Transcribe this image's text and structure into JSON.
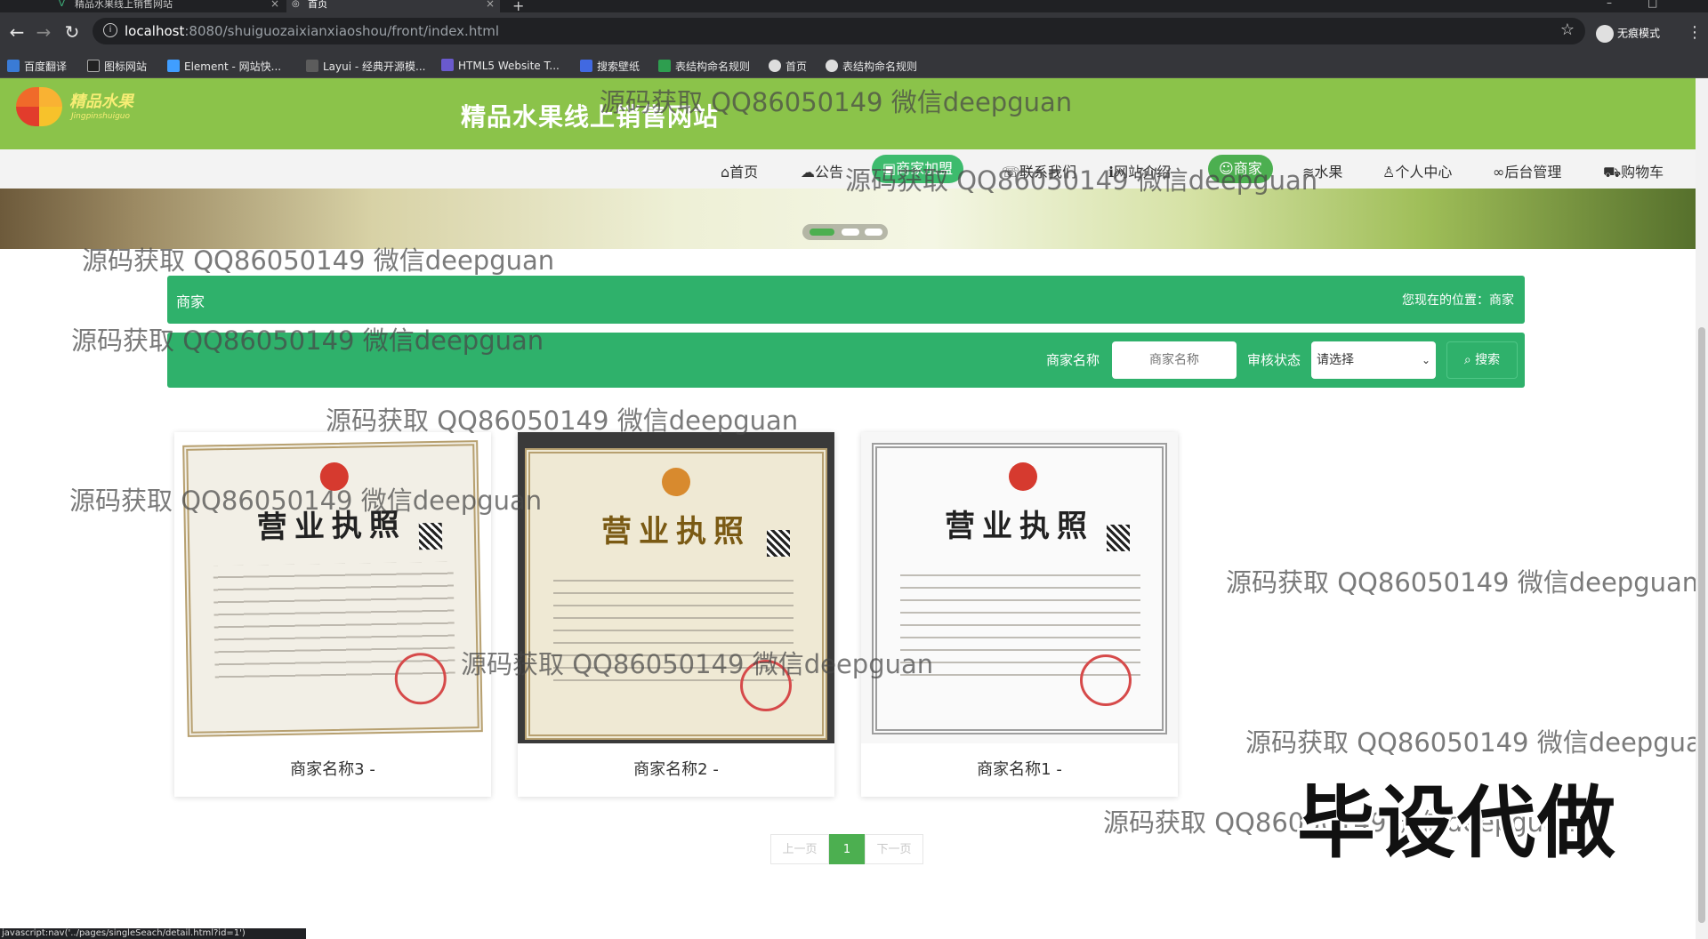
{
  "browser": {
    "tabs": [
      {
        "title": "精品水果线上销售网站"
      },
      {
        "title": "首页"
      }
    ],
    "url_host": "localhost",
    "url_rest": ":8080/shuiguozaixianxiaoshou/front/index.html",
    "profile_label": "无痕模式",
    "bookmarks": [
      "百度翻译",
      "图标网站",
      "Element - 网站快...",
      "Layui - 经典开源模...",
      "HTML5 Website T...",
      "搜索壁纸",
      "表结构命名规则",
      "首页",
      "表结构命名规则"
    ],
    "status_url": "javascript:nav('../pages/singleSeach/detail.html?id=1')"
  },
  "site": {
    "logo_text": "精品水果",
    "logo_sub": "Jingpinshuiguo",
    "title": "精品水果线上销售网站"
  },
  "nav": {
    "items": [
      "首页",
      "公告",
      "商家加盟",
      "联系我们",
      "网站介绍",
      "商家",
      "水果",
      "个人中心",
      "后台管理",
      "购物车"
    ],
    "icons": [
      "home-icon",
      "cloud-icon",
      "join-icon",
      "contact-icon",
      "info-icon",
      "store-icon",
      "fruit-icon",
      "user-icon",
      "link-icon",
      "cart-icon"
    ]
  },
  "banner": {
    "slide_count": 3,
    "active_index": 0
  },
  "section": {
    "title": "商家",
    "location": "您现在的位置：商家"
  },
  "search": {
    "name_label": "商家名称",
    "name_placeholder": "商家名称",
    "status_label": "审核状态",
    "status_selected": "请选择",
    "button_label": "搜索"
  },
  "cards": [
    {
      "name": "商家名称3 -",
      "image_caption": "营业执照"
    },
    {
      "name": "商家名称2 -",
      "image_caption": "营业执照"
    },
    {
      "name": "商家名称1 -",
      "image_caption": "营业执照"
    }
  ],
  "pager": {
    "prev": "上一页",
    "current": "1",
    "next": "下一页"
  },
  "overlays": {
    "watermark": "源码获取 QQ86050149 微信deepguan",
    "watermark_cut": "源码获取 QQ86050149 微信deepgua",
    "stamp": "毕设代做"
  },
  "colors": {
    "header_green": "#8bc34a",
    "accent_green": "#2fb16b",
    "pill_green": "#4caf50"
  }
}
